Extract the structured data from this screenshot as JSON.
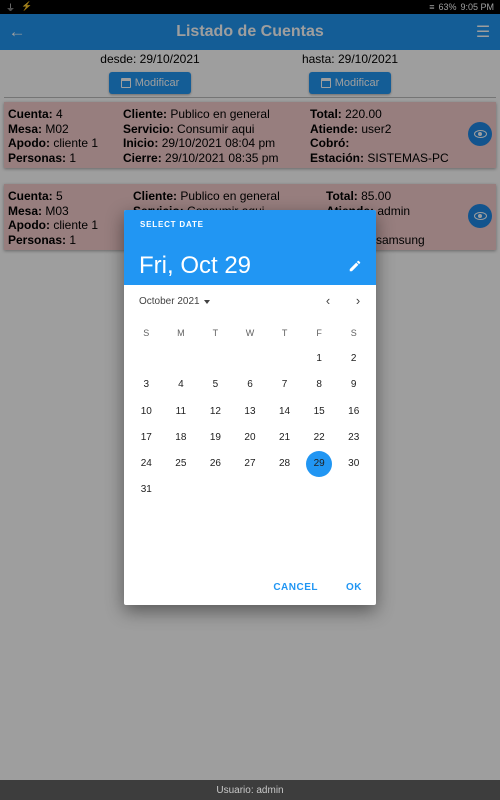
{
  "status_bar": {
    "left_icons": [
      "⏚",
      "⚡"
    ],
    "wifi_icon": "≡",
    "battery": "63%",
    "time": "9:05 PM"
  },
  "app_bar": {
    "back_icon": "arrow-back-icon",
    "title": "Listado de Cuentas",
    "menu_icon": "menu-icon"
  },
  "range": {
    "from_label": "desde: 29/10/2021",
    "to_label": "hasta: 29/10/2021",
    "modify_label": "Modificar"
  },
  "cards": [
    {
      "col1": [
        [
          "Cuenta:",
          "4"
        ],
        [
          "Mesa:",
          "M02"
        ],
        [
          "Apodo:",
          "cliente 1"
        ],
        [
          "Personas:",
          "1"
        ]
      ],
      "col2": [
        [
          "Cliente:",
          "Publico en general"
        ],
        [
          "Servicio:",
          "Consumir aqui"
        ],
        [
          "Inicio:",
          "29/10/2021 08:04 pm"
        ],
        [
          "Cierre:",
          "29/10/2021 08:35 pm"
        ]
      ],
      "col3": [
        [
          "Total:",
          "220.00"
        ],
        [
          "Atiende:",
          "user2"
        ],
        [
          "Cobró:",
          ""
        ],
        [
          "Estación:",
          "SISTEMAS-PC"
        ]
      ]
    },
    {
      "col1": [
        [
          "Cuenta:",
          "5"
        ],
        [
          "Mesa:",
          "M03"
        ],
        [
          "Apodo:",
          "cliente 1"
        ],
        [
          "Personas:",
          "1"
        ]
      ],
      "col2": [
        [
          "Cliente:",
          "Publico en general"
        ],
        [
          "Servicio:",
          "Consumir aqui"
        ],
        [
          "",
          ""
        ],
        [
          "",
          ""
        ]
      ],
      "col3": [
        [
          "Total:",
          "85.00"
        ],
        [
          "Atiende:",
          "admin"
        ],
        [
          "",
          ""
        ],
        [
          "",
          "samsung"
        ]
      ]
    }
  ],
  "date_picker": {
    "help_text": "SELECT DATE",
    "selected_date": "Fri, Oct 29",
    "month_label": "October 2021",
    "prev_icon": "‹",
    "next_icon": "›",
    "weekdays": [
      "S",
      "M",
      "T",
      "W",
      "T",
      "F",
      "S"
    ],
    "weeks": [
      [
        "",
        "",
        "",
        "",
        "",
        "1",
        "2"
      ],
      [
        "3",
        "4",
        "5",
        "6",
        "7",
        "8",
        "9"
      ],
      [
        "10",
        "11",
        "12",
        "13",
        "14",
        "15",
        "16"
      ],
      [
        "17",
        "18",
        "19",
        "20",
        "21",
        "22",
        "23"
      ],
      [
        "24",
        "25",
        "26",
        "27",
        "28",
        "29",
        "30"
      ],
      [
        "31",
        "",
        "",
        "",
        "",
        "",
        ""
      ]
    ],
    "selected_day": "29",
    "cancel_label": "CANCEL",
    "ok_label": "OK",
    "accent_color": "#2196F3"
  },
  "footer": {
    "user_label": "Usuario: admin"
  }
}
